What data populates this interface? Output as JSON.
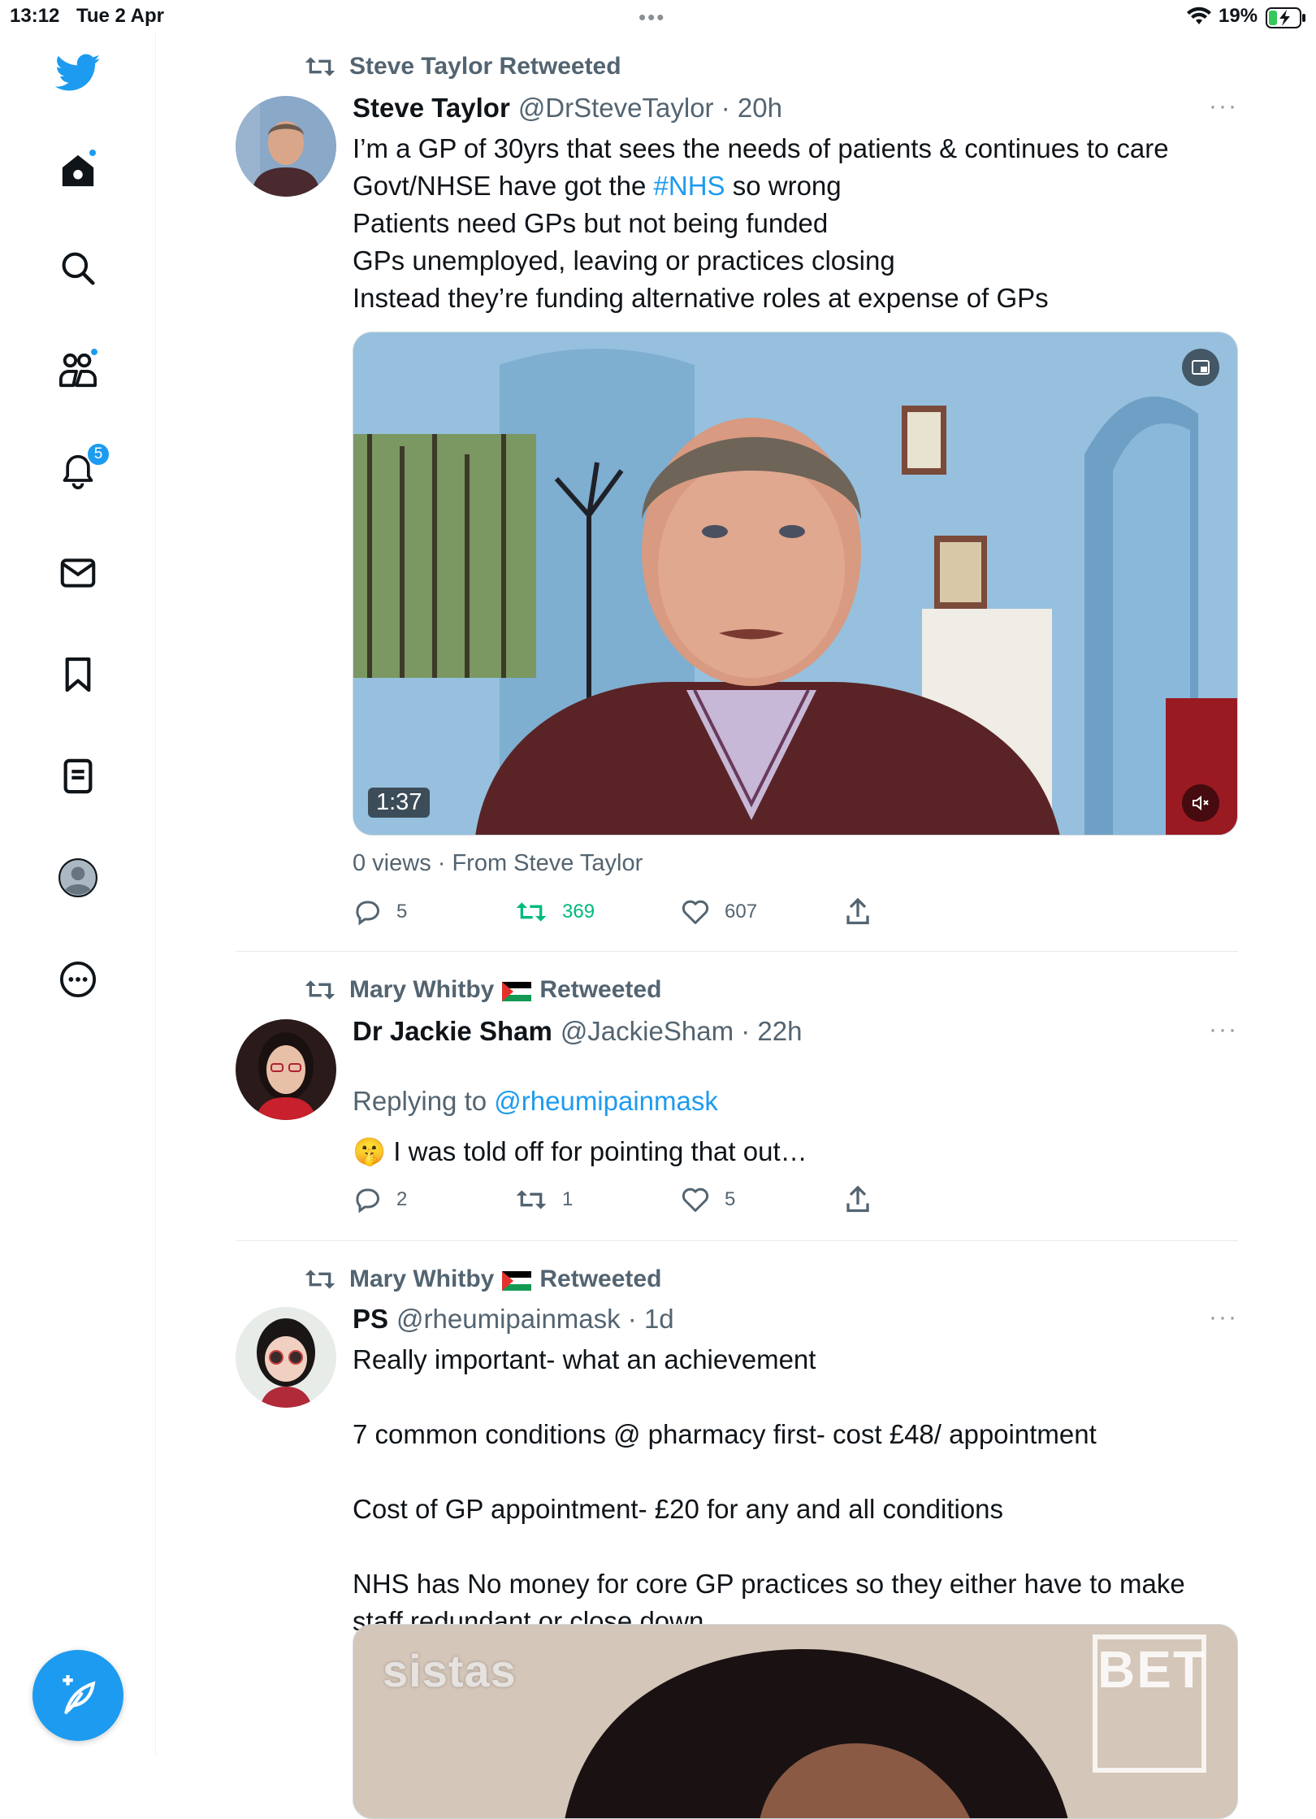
{
  "status_bar": {
    "time": "13:12",
    "date": "Tue 2 Apr",
    "battery": "19%",
    "dots": "•••"
  },
  "sidebar": {
    "notifications_badge": "5",
    "accent_color": "#1d9bf0"
  },
  "tweets": [
    {
      "retweeted_by": "Steve Taylor Retweeted",
      "name": "Steve Taylor",
      "handle_time": "@DrSteveTaylor · 20h",
      "more": "···",
      "text_before_link": "I’m a GP of 30yrs that sees the needs of patients & continues to care\nGovt/NHSE have got the ",
      "hashtag": "#NHS",
      "text_after_link": " so wrong\nPatients need GPs but not being funded\nGPs unemployed, leaving or practices closing\nInstead they’re funding alternative roles at expense of GPs",
      "video_duration": "1:37",
      "views": "0 views · From Steve Taylor",
      "replies": "5",
      "retweets": "369",
      "likes": "607"
    },
    {
      "retweeted_by_name": "Mary Whitby",
      "retweeted_suffix": "Retweeted",
      "name": "Dr Jackie Sham",
      "handle_time": "@JackieSham · 22h",
      "more": "···",
      "replying_prefix": "Replying to ",
      "replying_to": "@rheumipainmask",
      "emoji": "🤫",
      "text": "I was told off for pointing that out…",
      "replies": "2",
      "retweets": "1",
      "likes": "5"
    },
    {
      "retweeted_by_name": "Mary Whitby",
      "retweeted_suffix": "Retweeted",
      "name": "PS",
      "handle_time": "@rheumipainmask · 1d",
      "more": "···",
      "text": "Really important- what an achievement\n\n7 common conditions @ pharmacy first- cost £48/ appointment\n\nCost of GP appointment- £20 for any and all conditions\n\nNHS has No money for core GP practices so they either have to make staff redundant or close down",
      "media_watermark_left": "sistas",
      "media_watermark_right": "BET"
    }
  ]
}
